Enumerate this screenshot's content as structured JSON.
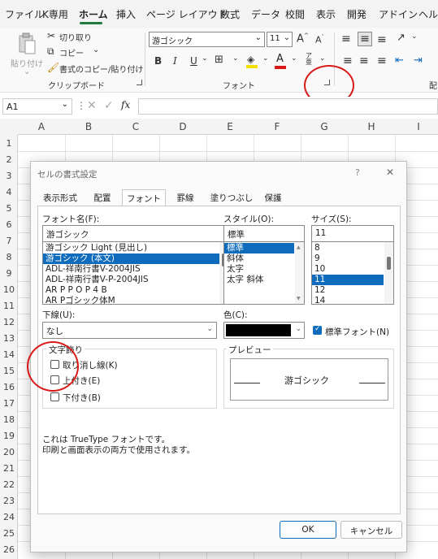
{
  "ribbon_tabs": [
    "ファイル",
    "K専用",
    "ホーム",
    "挿入",
    "ページ レイアウト",
    "数式",
    "データ",
    "校閲",
    "表示",
    "開発",
    "アドイン",
    "ヘルプ"
  ],
  "clipboard": {
    "paste": "貼り付け",
    "cut": "切り取り",
    "copy": "コピー",
    "format_painter": "書式のコピー/貼り付け",
    "group": "クリップボード"
  },
  "font_group": {
    "font_name": "游ゴシック",
    "font_size": "11",
    "grow": "A",
    "shrink": "A",
    "bold": "B",
    "italic": "I",
    "underline": "U",
    "font_color_glyph": "A",
    "group": "フォント"
  },
  "next_group_label": "配",
  "formula_bar": {
    "name_box": "A1",
    "fx": "fx"
  },
  "columns": [
    "A",
    "B",
    "C",
    "D",
    "E",
    "F",
    "G",
    "H",
    "I"
  ],
  "rows": [
    "1",
    "2",
    "3",
    "4",
    "5",
    "6",
    "7",
    "8",
    "9",
    "10",
    "11",
    "12",
    "13",
    "14",
    "15",
    "16",
    "17",
    "18",
    "19",
    "20",
    "21",
    "22",
    "23",
    "24",
    "25",
    "26"
  ],
  "dialog": {
    "title": "セルの書式設定",
    "help": "?",
    "close": "✕",
    "tabs": [
      "表示形式",
      "配置",
      "フォント",
      "罫線",
      "塗りつぶし",
      "保護"
    ],
    "active_tab": 2,
    "font_name_label": "フォント名(F):",
    "font_name_value": "游ゴシック",
    "font_list": [
      "游ゴシック Light (見出し)",
      "游ゴシック (本文)",
      "ADL-祥南行書V-2004JIS",
      "ADL-祥南行書V-P-2004JIS",
      "AR P P O P 4 B",
      "AR Pゴシック体M"
    ],
    "font_selected": 1,
    "style_label": "スタイル(O):",
    "style_value": "標準",
    "style_list": [
      "標準",
      "斜体",
      "太字",
      "太字 斜体"
    ],
    "style_selected": 0,
    "size_label": "サイズ(S):",
    "size_value": "11",
    "size_list": [
      "8",
      "9",
      "10",
      "11",
      "12",
      "14"
    ],
    "size_selected": 3,
    "underline_label": "下線(U):",
    "underline_value": "なし",
    "color_label": "色(C):",
    "color_value": "#000000",
    "normal_font_label": "標準フォント(N)",
    "normal_font_checked": true,
    "effects_label": "文字飾り",
    "strike_label": "取り消し線(K)",
    "super_label": "上付き(E)",
    "sub_label": "下付き(B)",
    "preview_label": "プレビュー",
    "preview_text": "游ゴシック",
    "info_line1": "これは TrueType フォントです。",
    "info_line2": "印刷と画面表示の両方で使用されます。",
    "ok": "OK",
    "cancel": "キャンセル"
  },
  "colors": {
    "accent": "#0f6cbd",
    "excel_green": "#1f7a3f",
    "annotation": "#d91818"
  }
}
